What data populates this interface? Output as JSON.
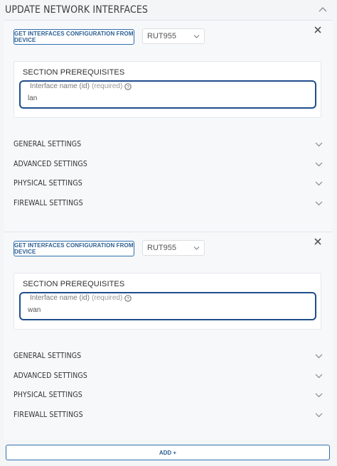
{
  "header": {
    "title": "UPDATE NETWORK INTERFACES",
    "chevron_icon": "chevron-up-icon"
  },
  "blocks": [
    {
      "get_button_label": "GET INTERFACES CONFIGURATION FROM DEVICE",
      "device_select_value": "RUT955",
      "prereq_title": "SECTION PREREQUISITES",
      "field_label": "Interface name (id)",
      "field_required": "(required)",
      "field_value": "lan",
      "sections": [
        "GENERAL SETTINGS",
        "ADVANCED SETTINGS",
        "PHYSICAL SETTINGS",
        "FIREWALL SETTINGS"
      ]
    },
    {
      "get_button_label": "GET INTERFACES CONFIGURATION FROM DEVICE",
      "device_select_value": "RUT955",
      "prereq_title": "SECTION PREREQUISITES",
      "field_label": "Interface name (id)",
      "field_required": "(required)",
      "field_value": "wan",
      "sections": [
        "GENERAL SETTINGS",
        "ADVANCED SETTINGS",
        "PHYSICAL SETTINGS",
        "FIREWALL SETTINGS"
      ]
    }
  ],
  "add_button_label": "ADD +",
  "colors": {
    "accent": "#2f6fae",
    "field_border": "#1f4e8c",
    "background": "#f4f5f7"
  }
}
